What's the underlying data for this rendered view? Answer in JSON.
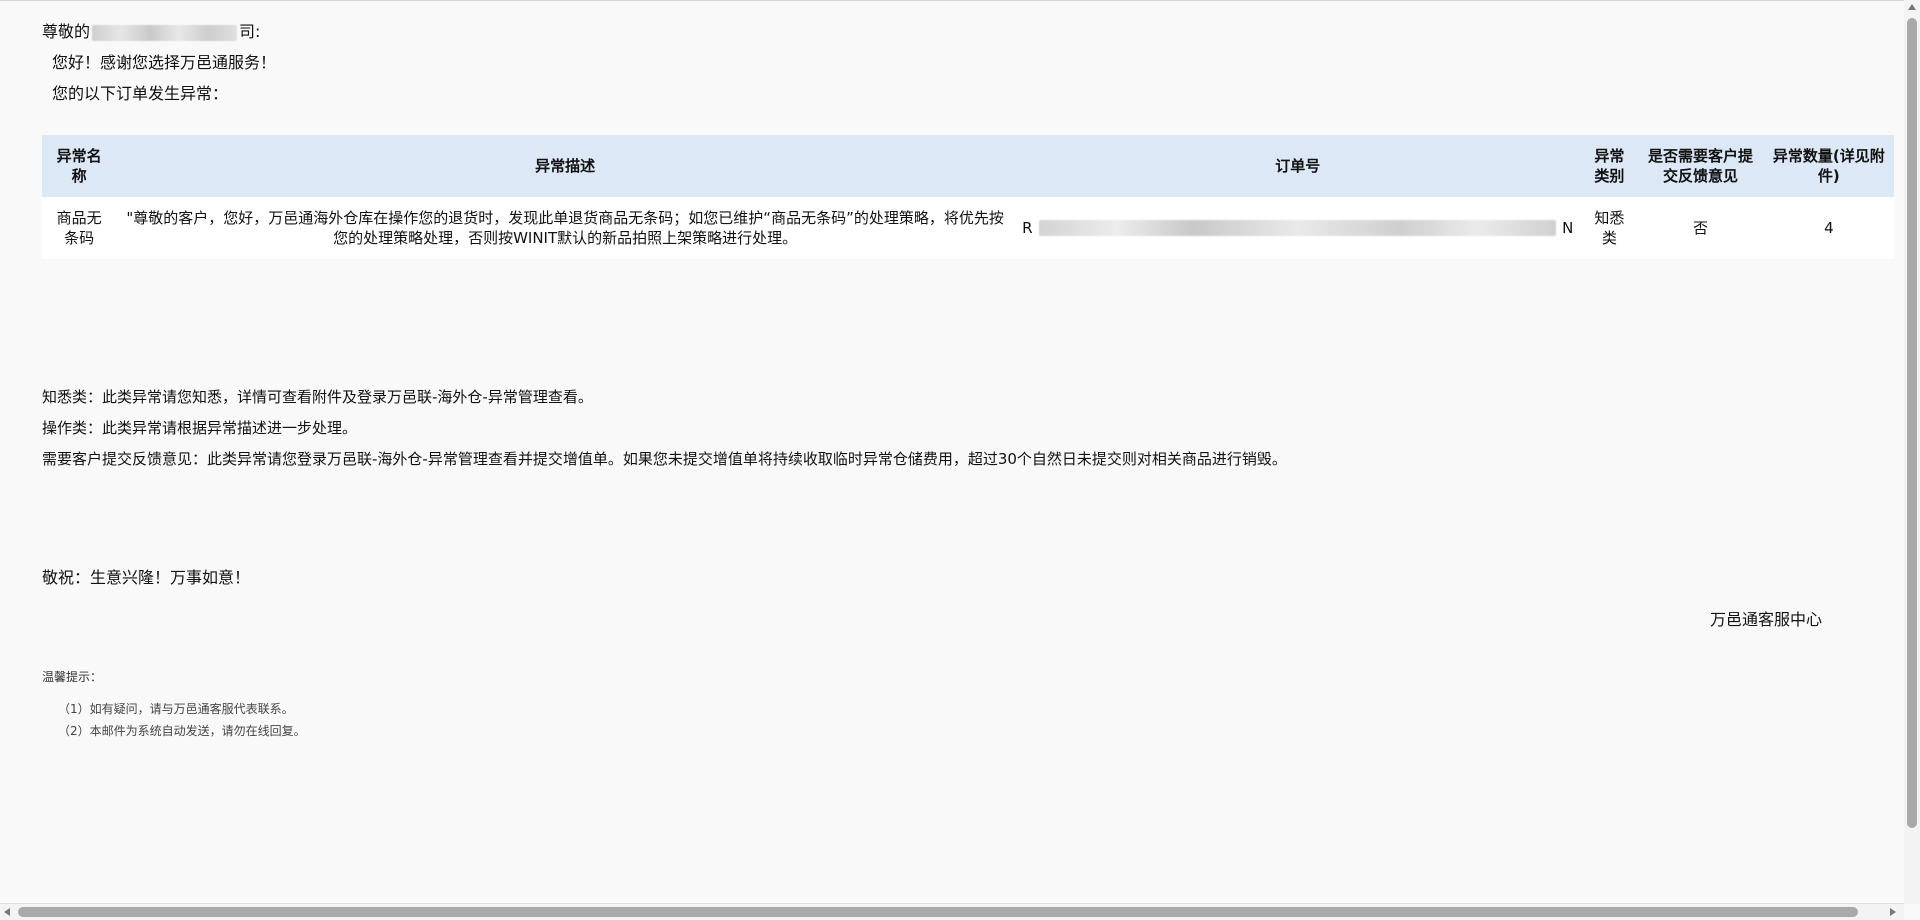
{
  "greeting": {
    "salutation_prefix": "尊敬的",
    "salutation_suffix": "司:",
    "hello": "您好！感谢您选择万邑通服务！",
    "intro": "您的以下订单发生异常："
  },
  "table": {
    "headers": [
      "异常名称",
      "异常描述",
      "订单号",
      "异常类别",
      "是否需要客户提交反馈意见",
      "异常数量(详见附件)"
    ],
    "rows": [
      {
        "name": "商品无条码",
        "description": "\"尊敬的客户，您好，万邑通海外仓库在操作您的退货时，发现此单退货商品无条码；如您已维护“商品无条码”的处理策略，将优先按您的处理策略处理，否则按WINIT默认的新品拍照上架策略进行处理。",
        "order_prefix": "R",
        "order_suffix": "N",
        "type": "知悉类",
        "need_feedback": "否",
        "quantity": "4"
      }
    ]
  },
  "notes": [
    "知悉类：此类异常请您知悉，详情可查看附件及登录万邑联-海外仓-异常管理查看。",
    "操作类：此类异常请根据异常描述进一步处理。",
    "需要客户提交反馈意见：此类异常请您登录万邑联-海外仓-异常管理查看并提交增值单。如果您未提交增值单将持续收取临时异常仓储费用，超过30个自然日未提交则对相关商品进行销毁。"
  ],
  "closing": "敬祝：生意兴隆！万事如意！",
  "signature": "万邑通客服中心",
  "tips": {
    "title": "温馨提示：",
    "items": [
      "（1）如有疑问，请与万邑通客服代表联系。",
      "（2）本邮件为系统自动发送，请勿在线回复。"
    ]
  },
  "colors": {
    "header_bg": "#dce8f5",
    "page_bg": "#f9f9f9"
  }
}
